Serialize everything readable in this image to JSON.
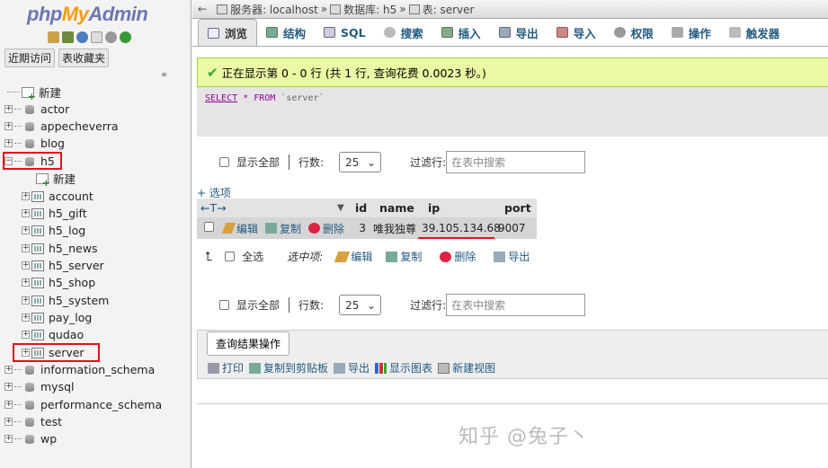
{
  "logo": {
    "php": "php",
    "my": "My",
    "admin": "Admin"
  },
  "nav_tabs": {
    "recent": "近期访问",
    "favorites": "表收藏夹"
  },
  "tree": {
    "new": "新建",
    "databases": [
      "actor",
      "appecheverra",
      "blog",
      "h5"
    ],
    "h5_children": {
      "new": "新建",
      "tables": [
        "account",
        "h5_gift",
        "h5_log",
        "h5_news",
        "h5_server",
        "h5_shop",
        "h5_system",
        "pay_log",
        "qudao",
        "server"
      ]
    },
    "more_databases": [
      "information_schema",
      "mysql",
      "performance_schema",
      "test",
      "wp"
    ]
  },
  "breadcrumb": {
    "server": "服务器: localhost",
    "database": "数据库: h5",
    "table": "表: server",
    "sep": "»"
  },
  "tabs": [
    "浏览",
    "结构",
    "SQL",
    "搜索",
    "插入",
    "导出",
    "导入",
    "权限",
    "操作",
    "触发器"
  ],
  "success_message": "正在显示第 0 - 0 行 (共 1 行, 查询花费 0.0023 秒。)",
  "sql": {
    "select": "SELECT",
    "star": "*",
    "from": "FROM",
    "table": "`server`"
  },
  "nav_controls": {
    "show_all": "显示全部",
    "rows_label": "行数:",
    "rows_value": "25",
    "filter_label": "过滤行:",
    "filter_placeholder": "在表中搜索"
  },
  "options_link": "+ 选项",
  "table": {
    "arrows": "←T→",
    "sort_icon": "▼",
    "columns": [
      "id",
      "name",
      "ip",
      "port"
    ],
    "row": {
      "edit": "编辑",
      "copy": "复制",
      "delete": "删除",
      "id": "3",
      "name": "唯我独尊",
      "ip": "39.105.134.68",
      "port": "9007"
    }
  },
  "with_selected": {
    "check_all": "全选",
    "label": "选中项:",
    "edit": "编辑",
    "copy": "复制",
    "delete": "删除",
    "export": "导出"
  },
  "query_ops": {
    "legend": "查询结果操作",
    "links": [
      "打印",
      "复制到剪贴板",
      "导出",
      "显示图表",
      "新建视图"
    ]
  },
  "watermark": "知乎 @兔子丶",
  "colors": {
    "link": "#235a81",
    "success_bg": "#ebf8a4",
    "highlight": "#e0131c"
  }
}
